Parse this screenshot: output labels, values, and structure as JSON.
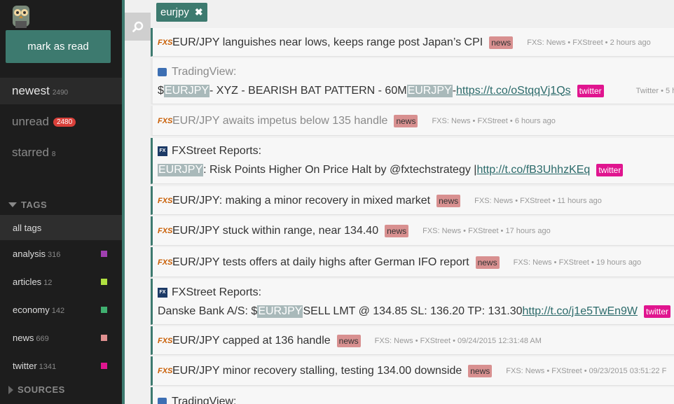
{
  "sidebar": {
    "mark_read": "mark as read",
    "nav": [
      {
        "label": "newest",
        "count": "2490"
      },
      {
        "label": "unread",
        "count": "2480"
      },
      {
        "label": "starred",
        "count": "8"
      }
    ],
    "tags_heading": "TAGS",
    "tags": [
      {
        "label": "all tags",
        "count": ""
      },
      {
        "label": "analysis",
        "count": "316",
        "color": "#a040b0"
      },
      {
        "label": "articles",
        "count": "12",
        "color": "#b0e040"
      },
      {
        "label": "economy",
        "count": "142",
        "color": "#40b070"
      },
      {
        "label": "news",
        "count": "669",
        "color": "#e09090"
      },
      {
        "label": "twitter",
        "count": "1341",
        "color": "#e0158f"
      }
    ],
    "sources_heading": "SOURCES"
  },
  "filter": {
    "label": "eurjpy"
  },
  "feed": {
    "items": [
      {
        "title": "EUR/JPY languishes near lows, keeps range post Japan’s CPI",
        "tag": "news",
        "source": "FXS: News",
        "author": "FXStreet",
        "time": "2 hours ago"
      },
      {
        "author_line": "TradingView:",
        "prefix": "$",
        "hl1": "EURJPY",
        "mid": " - XYZ - BEARISH BAT PATTERN - 60M ",
        "hl2": "EURJPY",
        "dash": " - ",
        "link": "https://t.co/oStqqVj1Qs",
        "tag": "twitter",
        "source": "Twitter",
        "time_partial": "5 h"
      },
      {
        "title": "EUR/JPY awaits impetus below 135 handle",
        "tag": "news",
        "source": "FXS: News",
        "author": "FXStreet",
        "time": "6 hours ago"
      },
      {
        "author_line": "FXStreet Reports:",
        "hl1": "EURJPY",
        "text": ": Risk Points Higher On Price Halt by @fxtechstrategy | ",
        "link": "http://t.co/fB3UhhzKEq",
        "tag": "twitter"
      },
      {
        "title": "EUR/JPY: making a minor recovery in mixed market",
        "tag": "news",
        "source": "FXS: News",
        "author": "FXStreet",
        "time": "11 hours ago"
      },
      {
        "title": "EUR/JPY stuck within range, near 134.40",
        "tag": "news",
        "source": "FXS: News",
        "author": "FXStreet",
        "time": "17 hours ago"
      },
      {
        "title": "EUR/JPY tests offers at daily highs after German IFO report",
        "tag": "news",
        "source": "FXS: News",
        "author": "FXStreet",
        "time": "19 hours ago"
      },
      {
        "author_line": "FXStreet Reports:",
        "prefix": "Danske Bank A/S: $",
        "hl1": "EURJPY",
        "text": " SELL LMT @ 134.85 SL: 136.20 TP: 131.30 ",
        "link": "http://t.co/j1e5TwEn9W",
        "tag": "twitter"
      },
      {
        "title": "EUR/JPY capped at 136 handle",
        "tag": "news",
        "source": "FXS: News",
        "author": "FXStreet",
        "time": "09/24/2015 12:31:48 AM"
      },
      {
        "title": "EUR/JPY minor recovery stalling, testing 134.00 downside",
        "tag": "news",
        "source": "FXS: News",
        "author": "FXStreet",
        "time": "09/23/2015 03:51:22 F"
      },
      {
        "author_line": "TradingView:"
      }
    ]
  }
}
